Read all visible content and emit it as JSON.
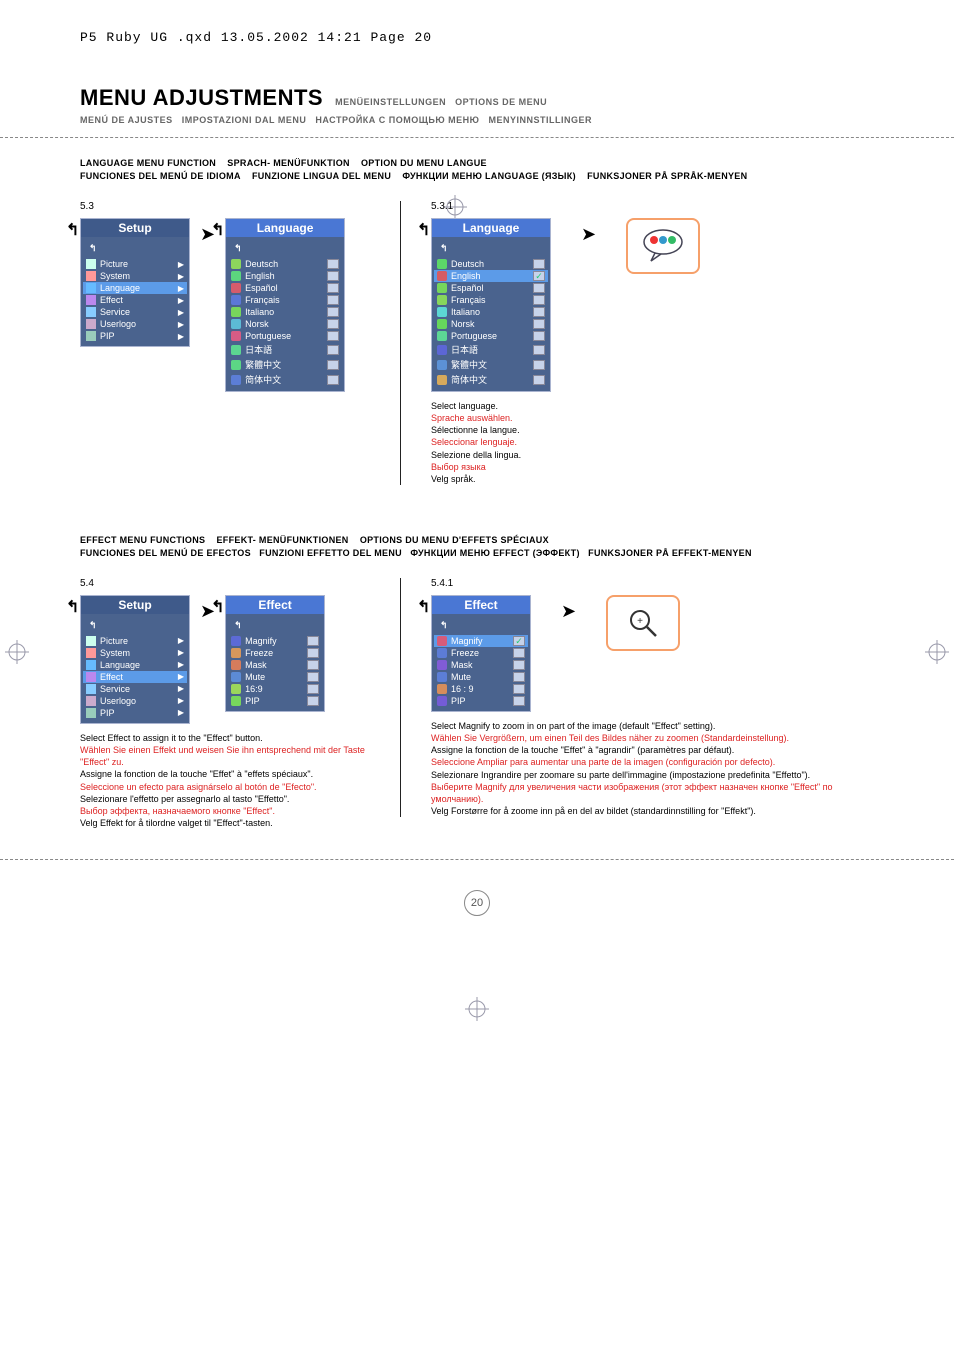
{
  "editor_header": "P5 Ruby UG .qxd   13.05.2002   14:21   Page 20",
  "main_title": "MENU ADJUSTMENTS",
  "subtitles1": [
    "MENÜEINSTELLUNGEN",
    "OPTIONS DE MENU"
  ],
  "subtitles2": [
    "MENÚ DE AJUSTES",
    "IMPOSTAZIONI DAL MENU",
    "НАСТРОЙКА С ПОМОЩЬЮ МЕНЮ",
    "MENYINNSTILLINGER"
  ],
  "lang_section_heads1": [
    "LANGUAGE MENU FUNCTION",
    "SPRACH- MENÜFUNKTION",
    "OPTION DU MENU LANGUE"
  ],
  "lang_section_heads2": [
    "FUNCIONES DEL MENÚ DE IDIOMA",
    "FUNZIONE LINGUA DEL MENU",
    "ФУНКЦИИ МЕНЮ LANGUAGE (ЯЗЫК)",
    "FUNKSJONER PÅ SPRÅK-MENYEN"
  ],
  "fig_53": "5.3",
  "fig_531": "5.3.1",
  "setup_title": "Setup",
  "language_title": "Language",
  "effect_title": "Effect",
  "setup_items_lang": [
    {
      "icon": "pic",
      "label": "Picture",
      "sel": false
    },
    {
      "icon": "sys",
      "label": "System",
      "sel": false
    },
    {
      "icon": "lang",
      "label": "Language",
      "sel": true
    },
    {
      "icon": "eff",
      "label": "Effect",
      "sel": false
    },
    {
      "icon": "srv",
      "label": "Service",
      "sel": false
    },
    {
      "icon": "usr",
      "label": "Userlogo",
      "sel": false
    },
    {
      "icon": "pip",
      "label": "PIP",
      "sel": false
    }
  ],
  "language_items": [
    {
      "label": "Deutsch",
      "chk": false
    },
    {
      "label": "English",
      "chk": false
    },
    {
      "label": "Español",
      "chk": false
    },
    {
      "label": "Français",
      "chk": false
    },
    {
      "label": "Italiano",
      "chk": false
    },
    {
      "label": "Norsk",
      "chk": false
    },
    {
      "label": "Portuguese",
      "chk": false
    },
    {
      "label": "日本語",
      "chk": false
    },
    {
      "label": "繁體中文",
      "chk": false
    },
    {
      "label": "简体中文",
      "chk": false
    }
  ],
  "language_items_531": [
    {
      "label": "Deutsch",
      "sel": false,
      "chk": false
    },
    {
      "label": "English",
      "sel": true,
      "chk": true
    },
    {
      "label": "Español",
      "sel": false,
      "chk": false
    },
    {
      "label": "Français",
      "sel": false,
      "chk": false
    },
    {
      "label": "Italiano",
      "sel": false,
      "chk": false
    },
    {
      "label": "Norsk",
      "sel": false,
      "chk": false
    },
    {
      "label": "Portuguese",
      "sel": false,
      "chk": false
    },
    {
      "label": "日本語",
      "sel": false,
      "chk": false
    },
    {
      "label": "繁體中文",
      "sel": false,
      "chk": false
    },
    {
      "label": "简体中文",
      "sel": false,
      "chk": false
    }
  ],
  "lang_desc": {
    "en": "Select language.",
    "de": "Sprache auswählen.",
    "fr": "Sélectionne la langue.",
    "es": "Seleccionar lenguaje.",
    "it": "Selezione della lingua.",
    "ru": "Выбор языка",
    "no": "Velg språk."
  },
  "effect_section_heads1": [
    "EFFECT MENU FUNCTIONS",
    "EFFEKT- MENÜFUNKTIONEN",
    "OPTIONS DU MENU D'EFFETS SPÉCIAUX"
  ],
  "effect_section_heads2": [
    "FUNCIONES DEL MENÚ DE EFECTOS",
    "FUNZIONI EFFETTO DEL MENU",
    "ФУНКЦИИ МЕНЮ EFFECT (ЭФФЕКТ)",
    "FUNKSJONER PÅ EFFEKT-MENYEN"
  ],
  "fig_54": "5.4",
  "fig_541": "5.4.1",
  "setup_items_eff": [
    {
      "icon": "pic",
      "label": "Picture",
      "sel": false
    },
    {
      "icon": "sys",
      "label": "System",
      "sel": false
    },
    {
      "icon": "lang",
      "label": "Language",
      "sel": false
    },
    {
      "icon": "eff",
      "label": "Effect",
      "sel": true
    },
    {
      "icon": "srv",
      "label": "Service",
      "sel": false
    },
    {
      "icon": "usr",
      "label": "Userlogo",
      "sel": false
    },
    {
      "icon": "pip",
      "label": "PIP",
      "sel": false
    }
  ],
  "effect_items": [
    {
      "label": "Magnify",
      "chk": false
    },
    {
      "label": "Freeze",
      "chk": false
    },
    {
      "label": "Mask",
      "chk": false
    },
    {
      "label": "Mute",
      "chk": false
    },
    {
      "label": "16:9",
      "chk": false
    },
    {
      "label": "PIP",
      "chk": false
    }
  ],
  "effect_items_541": [
    {
      "label": "Magnify",
      "sel": true,
      "chk": true
    },
    {
      "label": "Freeze",
      "sel": false,
      "chk": false
    },
    {
      "label": "Mask",
      "sel": false,
      "chk": false
    },
    {
      "label": "Mute",
      "sel": false,
      "chk": false
    },
    {
      "label": "16 : 9",
      "sel": false,
      "chk": false
    },
    {
      "label": "PIP",
      "sel": false,
      "chk": false
    }
  ],
  "effect_desc_left": {
    "en": "Select Effect to assign it to the \"Effect\" button.",
    "de": "Wählen Sie einen Effekt und weisen Sie ihn entsprechend mit der Taste \"Effect\" zu.",
    "fr": "Assigne la fonction de la touche \"Effet\" à \"effets spéciaux\".",
    "es": "Seleccione un efecto para asignárselo al botón de \"Efecto\".",
    "it": "Selezionare l'effetto per assegnarlo al tasto \"Effetto\".",
    "ru": "Выбор эффекта, назначаемого кнопке \"Effect\".",
    "no": "Velg Effekt for å tilordne valget til \"Effect\"-tasten."
  },
  "effect_desc_right": {
    "en": "Select Magnify to zoom in on part of the image (default \"Effect\" setting).",
    "de": "Wählen Sie Vergrößern, um einen Teil des Bildes näher zu zoomen (Standardeinstellung).",
    "fr": "Assigne la fonction de la touche \"Effet\" à \"agrandir\" (paramètres par défaut).",
    "es": "Seleccione Ampliar para aumentar una parte de la imagen (configuración por defecto).",
    "it": "Selezionare Ingrandire per zoomare su parte dell'immagine (impostazione predefinita \"Effetto\").",
    "ru": "Выберите Magnify для увеличения части изображения (этот эффект назначен кнопке \"Effect\" по умолчанию).",
    "no": "Velg Forstørre for å zoome inn på en del av bildet (standardinnstilling for \"Effekt\")."
  },
  "page_number": "20"
}
